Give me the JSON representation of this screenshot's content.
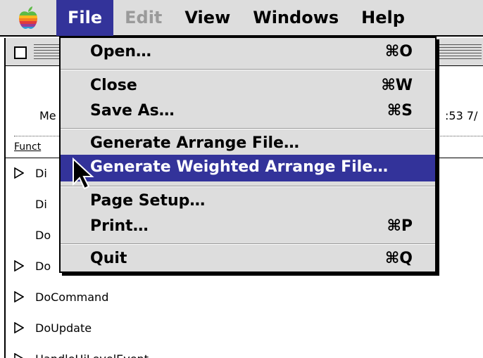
{
  "menubar": {
    "apple_icon": "apple-logo-icon",
    "menus": [
      {
        "label": "File",
        "state": "active"
      },
      {
        "label": "Edit",
        "state": "disabled"
      },
      {
        "label": "View",
        "state": "normal"
      },
      {
        "label": "Windows",
        "state": "normal"
      },
      {
        "label": "Help",
        "state": "normal"
      }
    ]
  },
  "window": {
    "header_left": "Me",
    "header_right": ":53 7/",
    "column_label": "Funct",
    "rows": [
      {
        "label": "Di",
        "expandable": true
      },
      {
        "label": "Di",
        "expandable": false
      },
      {
        "label": "Do",
        "expandable": false
      },
      {
        "label": "Do",
        "expandable": true
      },
      {
        "label": "DoCommand",
        "expandable": true
      },
      {
        "label": "DoUpdate",
        "expandable": true
      },
      {
        "label": "HandleHiLevelEvent",
        "expandable": true
      }
    ]
  },
  "file_menu": {
    "items": [
      {
        "label": "Open…",
        "shortcut": "⌘O"
      },
      {
        "label": "Close",
        "shortcut": "⌘W"
      },
      {
        "label": "Save As…",
        "shortcut": "⌘S"
      },
      {
        "label": "Generate Arrange File…",
        "shortcut": ""
      },
      {
        "label": "Generate Weighted Arrange File…",
        "shortcut": "",
        "highlighted": true
      },
      {
        "label": "Page Setup…",
        "shortcut": ""
      },
      {
        "label": "Print…",
        "shortcut": "⌘P"
      },
      {
        "label": "Quit",
        "shortcut": "⌘Q"
      }
    ]
  },
  "colors": {
    "highlight": "#33339a",
    "menu_background": "#dddddd",
    "disabled_text": "#9a9a9a"
  }
}
